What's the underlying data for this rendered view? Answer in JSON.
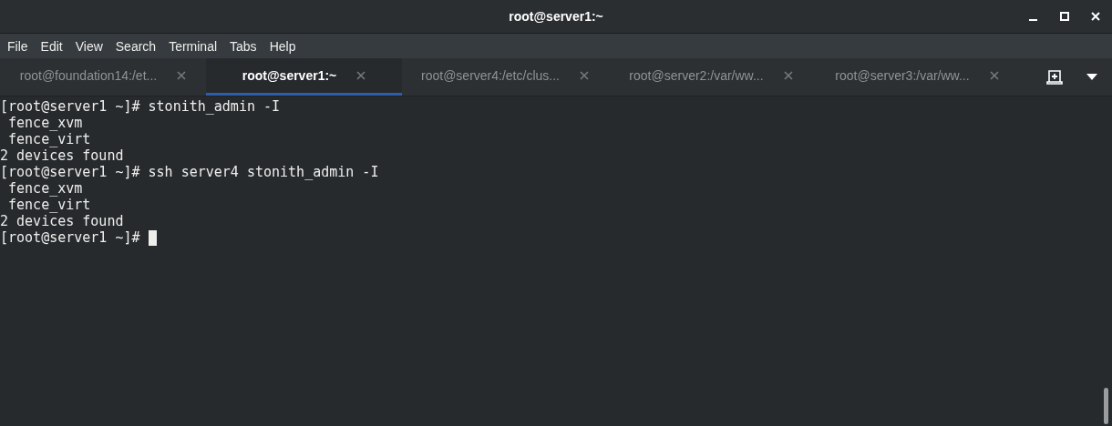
{
  "window": {
    "title": "root@server1:~"
  },
  "menu": [
    "File",
    "Edit",
    "View",
    "Search",
    "Terminal",
    "Tabs",
    "Help"
  ],
  "tabs": [
    {
      "label": "root@foundation14:/et...",
      "selected": false
    },
    {
      "label": "root@server1:~",
      "selected": true
    },
    {
      "label": "root@server4:/etc/clus...",
      "selected": false
    },
    {
      "label": "root@server2:/var/ww...",
      "selected": false
    },
    {
      "label": "root@server3:/var/ww...",
      "selected": false
    }
  ],
  "terminal": {
    "lines": [
      "[root@server1 ~]# stonith_admin -I",
      " fence_xvm",
      " fence_virt",
      "2 devices found",
      "[root@server1 ~]# ssh server4 stonith_admin -I",
      " fence_xvm",
      " fence_virt",
      "2 devices found",
      "[root@server1 ~]# "
    ],
    "cursor": true
  }
}
